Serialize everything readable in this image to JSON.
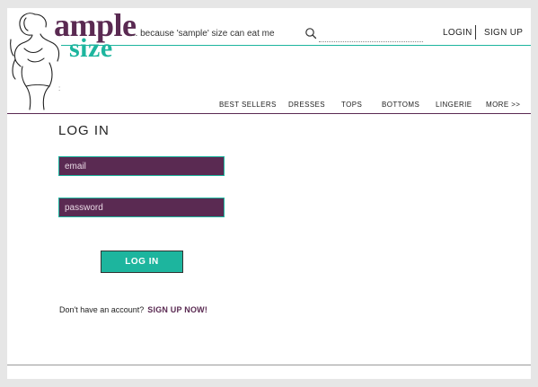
{
  "brand": {
    "name_part1": "ample",
    "name_part2": "size",
    "tagline": "... because 'sample' size can eat me"
  },
  "header": {
    "search_placeholder": "",
    "login_label": "LOGIN",
    "signup_label": "SIGN UP",
    "colon_mark": ":"
  },
  "nav": {
    "items": [
      "BEST SELLERS",
      "DRESSES",
      "TOPS",
      "BOTTOMS",
      "LINGERIE",
      "MORE >>"
    ]
  },
  "login_form": {
    "heading": "LOG IN",
    "email_placeholder": "email",
    "password_placeholder": "password",
    "submit_label": "LOG IN",
    "signup_prompt": "Don't have an account?",
    "signup_link": "SIGN UP NOW!"
  },
  "colors": {
    "brand_purple": "#5a2a52",
    "brand_teal": "#1db59e"
  },
  "icons": [
    "logo-figure-icon",
    "search-icon"
  ]
}
